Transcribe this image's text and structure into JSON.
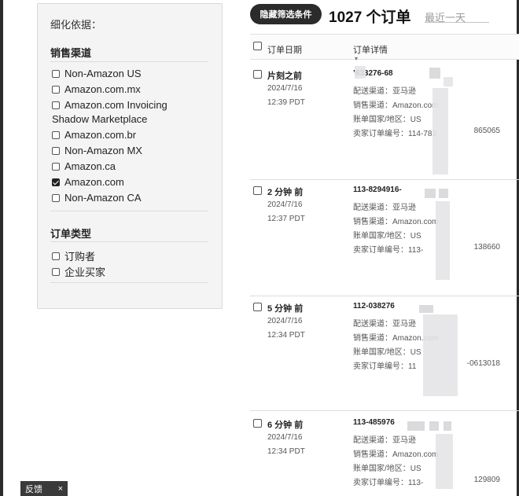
{
  "sidebar": {
    "heading": "细化依据：",
    "sales_channel": {
      "title": "销售渠道",
      "items": [
        {
          "label": "Non-Amazon US",
          "checked": false
        },
        {
          "label": "Amazon.com.mx",
          "checked": false
        },
        {
          "label": "Amazon.com Invoicing",
          "label2": "Shadow Marketplace",
          "checked": false
        },
        {
          "label": "Amazon.com.br",
          "checked": false
        },
        {
          "label": "Non-Amazon MX",
          "checked": false
        },
        {
          "label": "Amazon.ca",
          "checked": false
        },
        {
          "label": "Amazon.com",
          "checked": true
        },
        {
          "label": "Non-Amazon CA",
          "checked": false
        }
      ]
    },
    "order_type": {
      "title": "订单类型",
      "items": [
        {
          "label": "订购者",
          "checked": false
        },
        {
          "label": "企业买家",
          "checked": false
        }
      ]
    }
  },
  "header": {
    "filter_button": "隐藏筛选条件",
    "order_count": "1027 个订单",
    "date_range": "最近一天"
  },
  "table": {
    "col_date": "订单日期",
    "col_detail": "订单详情",
    "col_detail_mark": "▾"
  },
  "orders": [
    {
      "when": "片刻之前",
      "date": "2024/7/16",
      "time": "12:39 PDT",
      "order_id": "’833276-68",
      "delivery": "配送渠道：亚马逊",
      "channel": "销售渠道：Amazon.com",
      "country": "账单国家/地区：US",
      "seller_id": "卖家订单编号：114-783",
      "seller_id_tail": "865065"
    },
    {
      "when": "2 分钟 前",
      "date": "2024/7/16",
      "time": "12:37 PDT",
      "order_id": "113-8294916-",
      "delivery": "配送渠道：亚马逊",
      "channel": "销售渠道：Amazon.com",
      "country": "账单国家/地区：US",
      "seller_id": "卖家订单编号：113-",
      "seller_id_tail": "138660"
    },
    {
      "when": "5 分钟 前",
      "date": "2024/7/16",
      "time": "12:34 PDT",
      "order_id": "112-038276",
      "delivery": "配送渠道：亚马逊",
      "channel": "销售渠道：Amazon.com",
      "country": "账单国家/地区：US",
      "seller_id": "卖家订单编号：11",
      "seller_id_tail": "-0613018"
    },
    {
      "when": "6 分钟 前",
      "date": "2024/7/16",
      "time": "12:34 PDT",
      "order_id": "113-485976",
      "delivery": "配送渠道：亚马逊",
      "channel": "销售渠道：Amazon.com",
      "country": "账单国家/地区：US",
      "seller_id": "卖家订单编号：113-",
      "seller_id_tail": "129809"
    }
  ],
  "feedback": {
    "label": "反馈",
    "close": "×"
  }
}
